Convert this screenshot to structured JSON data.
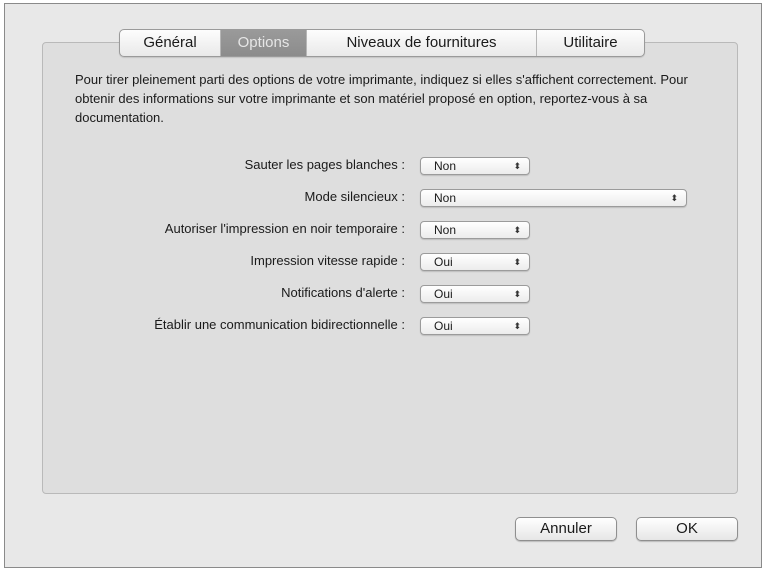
{
  "tabs": [
    {
      "label": "Général",
      "selected": false
    },
    {
      "label": "Options",
      "selected": true
    },
    {
      "label": "Niveaux de fournitures",
      "selected": false
    },
    {
      "label": "Utilitaire",
      "selected": false
    }
  ],
  "description": "Pour tirer pleinement parti des options de votre imprimante, indiquez si elles s'affichent correctement. Pour obtenir des informations sur votre imprimante et son matériel proposé en option, reportez-vous à sa documentation.",
  "options": [
    {
      "label": "Sauter les pages blanches :",
      "value": "Non"
    },
    {
      "label": "Mode silencieux :",
      "value": "Non"
    },
    {
      "label": "Autoriser l'impression en noir temporaire :",
      "value": "Non"
    },
    {
      "label": "Impression vitesse rapide :",
      "value": "Oui"
    },
    {
      "label": "Notifications d'alerte :",
      "value": "Oui"
    },
    {
      "label": "Établir une communication bidirectionnelle :",
      "value": "Oui"
    }
  ],
  "popup_arrow_glyph": "⬍",
  "buttons": {
    "cancel": "Annuler",
    "ok": "OK"
  }
}
